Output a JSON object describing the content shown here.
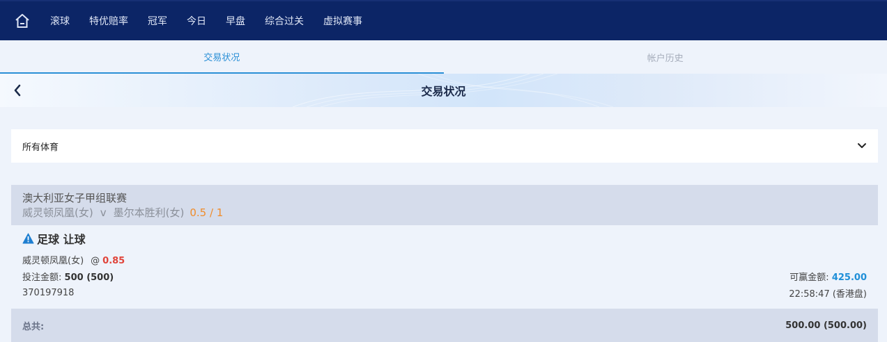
{
  "nav": {
    "items": [
      "滚球",
      "特优赔率",
      "冠军",
      "今日",
      "早盘",
      "综合过关",
      "虚拟赛事"
    ]
  },
  "tabs": [
    {
      "label": "交易状况",
      "active": true
    },
    {
      "label": "帐户历史",
      "active": false
    }
  ],
  "banner": {
    "title": "交易状况"
  },
  "filter": {
    "selected": "所有体育"
  },
  "league": {
    "name": "澳大利亚女子甲组联赛",
    "home": "威灵顿凤凰(女)",
    "vs": "v",
    "away": "墨尔本胜利(女)",
    "handicap": "0.5 / 1"
  },
  "bet": {
    "type": "足球 让球",
    "selection": "威灵顿凤凰(女)",
    "at": "@",
    "odds": "0.85",
    "stake_label": "投注金额:",
    "stake_value": "500 (500)",
    "win_label": "可赢金额:",
    "win_value": "425.00",
    "ticket_id": "370197918",
    "time": "22:58:47 (香港盘)"
  },
  "total": {
    "label": "总共:",
    "value": "500.00 (500.00)"
  },
  "colors": {
    "nav_bg": "#0c2566",
    "accent": "#2a8fd6",
    "odds": "#e0443a",
    "handicap": "#f08c2a",
    "warning_icon": "#1f7fd1"
  }
}
